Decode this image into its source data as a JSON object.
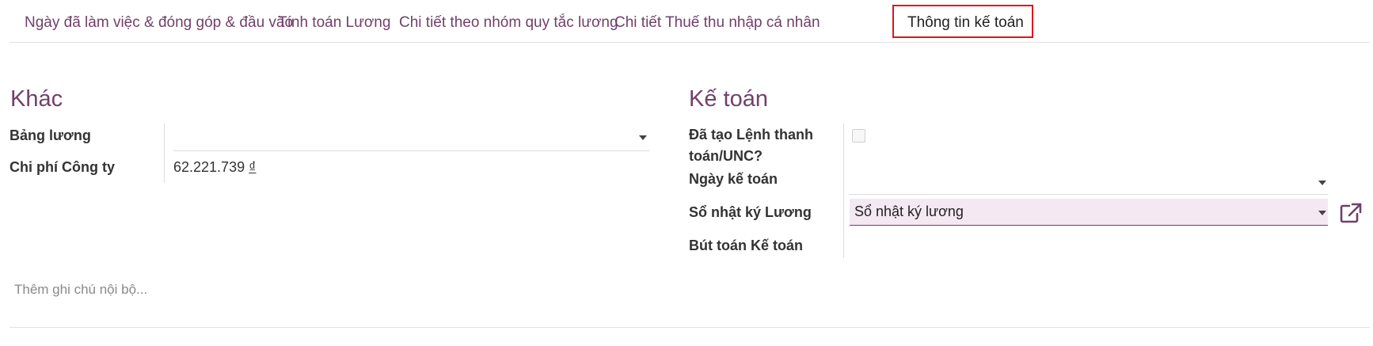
{
  "tabs": [
    {
      "label": "Ngày đã làm việc & đóng góp & đầu vào"
    },
    {
      "label": "Tính toán Lương"
    },
    {
      "label": "Chi tiết theo nhóm quy tắc lương"
    },
    {
      "label": "Chi tiết Thuế thu nhập cá nhân"
    },
    {
      "label": "Thông tin kế toán",
      "active": true
    }
  ],
  "other": {
    "title": "Khác",
    "payroll_label": "Bảng lương",
    "payroll_value": "",
    "company_cost_label": "Chi phí Công ty",
    "company_cost_amount": "62.221.739",
    "currency_symbol": "₫"
  },
  "accounting": {
    "title": "Kế toán",
    "payment_order_label": "Đã tạo Lệnh thanh toán/UNC?",
    "payment_order_checked": false,
    "accounting_date_label": "Ngày kế toán",
    "accounting_date_value": "",
    "journal_label": "Sổ nhật ký Lương",
    "journal_value": "Sổ nhật ký lương",
    "journal_entry_label": "Bút toán Kế toán",
    "journal_entry_value": ""
  },
  "internal_note": {
    "placeholder": "Thêm ghi chú nội bộ..."
  },
  "colors": {
    "accent": "#71406b",
    "highlight_border": "#e0141e",
    "field_bg": "#f4e8f2"
  },
  "icons": [
    "caret-down-icon",
    "external-link-icon"
  ]
}
